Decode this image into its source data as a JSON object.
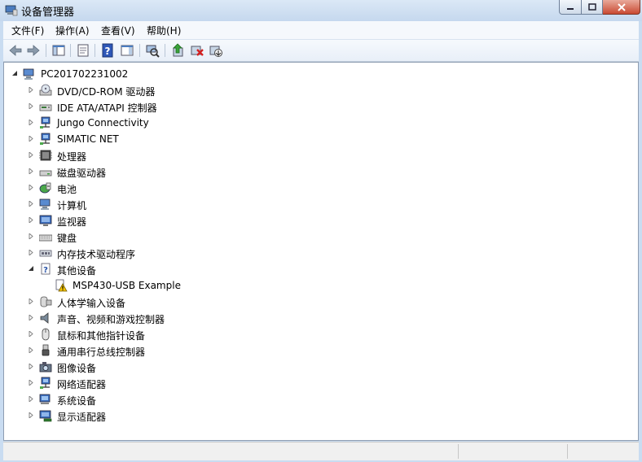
{
  "window": {
    "title": "设备管理器",
    "icons": {
      "app": "device-manager-icon",
      "minimize": "minimize-icon",
      "maximize": "maximize-icon",
      "close": "close-icon"
    }
  },
  "menu": {
    "file": "文件(F)",
    "action": "操作(A)",
    "view": "查看(V)",
    "help": "帮助(H)"
  },
  "toolbar": {
    "icons": [
      "back-arrow-icon",
      "forward-arrow-icon",
      "show-hide-console-tree-icon",
      "properties-icon",
      "help-icon",
      "action-pane-icon",
      "scan-hardware-icon",
      "update-driver-icon",
      "uninstall-icon",
      "disable-device-icon"
    ]
  },
  "tree": {
    "root": "PC201702231002",
    "items": [
      {
        "label": "DVD/CD-ROM 驱动器",
        "icon": "dvd-drive-icon"
      },
      {
        "label": "IDE ATA/ATAPI 控制器",
        "icon": "ide-controller-icon"
      },
      {
        "label": "Jungo Connectivity",
        "icon": "network-device-icon"
      },
      {
        "label": "SIMATIC NET",
        "icon": "network-device-icon"
      },
      {
        "label": "处理器",
        "icon": "processor-icon"
      },
      {
        "label": "磁盘驱动器",
        "icon": "disk-drive-icon"
      },
      {
        "label": "电池",
        "icon": "battery-icon"
      },
      {
        "label": "计算机",
        "icon": "computer-icon"
      },
      {
        "label": "监视器",
        "icon": "monitor-icon"
      },
      {
        "label": "键盘",
        "icon": "keyboard-icon"
      },
      {
        "label": "内存技术驱动程序",
        "icon": "memory-icon"
      },
      {
        "label": "其他设备",
        "icon": "unknown-device-icon",
        "expanded": true,
        "children": [
          {
            "label": "MSP430-USB Example",
            "icon": "warning-device-icon"
          }
        ]
      },
      {
        "label": "人体学输入设备",
        "icon": "hid-icon"
      },
      {
        "label": "声音、视频和游戏控制器",
        "icon": "speaker-icon"
      },
      {
        "label": "鼠标和其他指针设备",
        "icon": "mouse-icon"
      },
      {
        "label": "通用串行总线控制器",
        "icon": "usb-icon"
      },
      {
        "label": "图像设备",
        "icon": "camera-icon"
      },
      {
        "label": "网络适配器",
        "icon": "network-adapter-icon"
      },
      {
        "label": "系统设备",
        "icon": "system-device-icon"
      },
      {
        "label": "显示适配器",
        "icon": "display-adapter-icon"
      }
    ]
  },
  "colors": {
    "titlebar": "#c9dcf1",
    "tree_bg": "#ffffff",
    "close_button": "#c94a32"
  }
}
